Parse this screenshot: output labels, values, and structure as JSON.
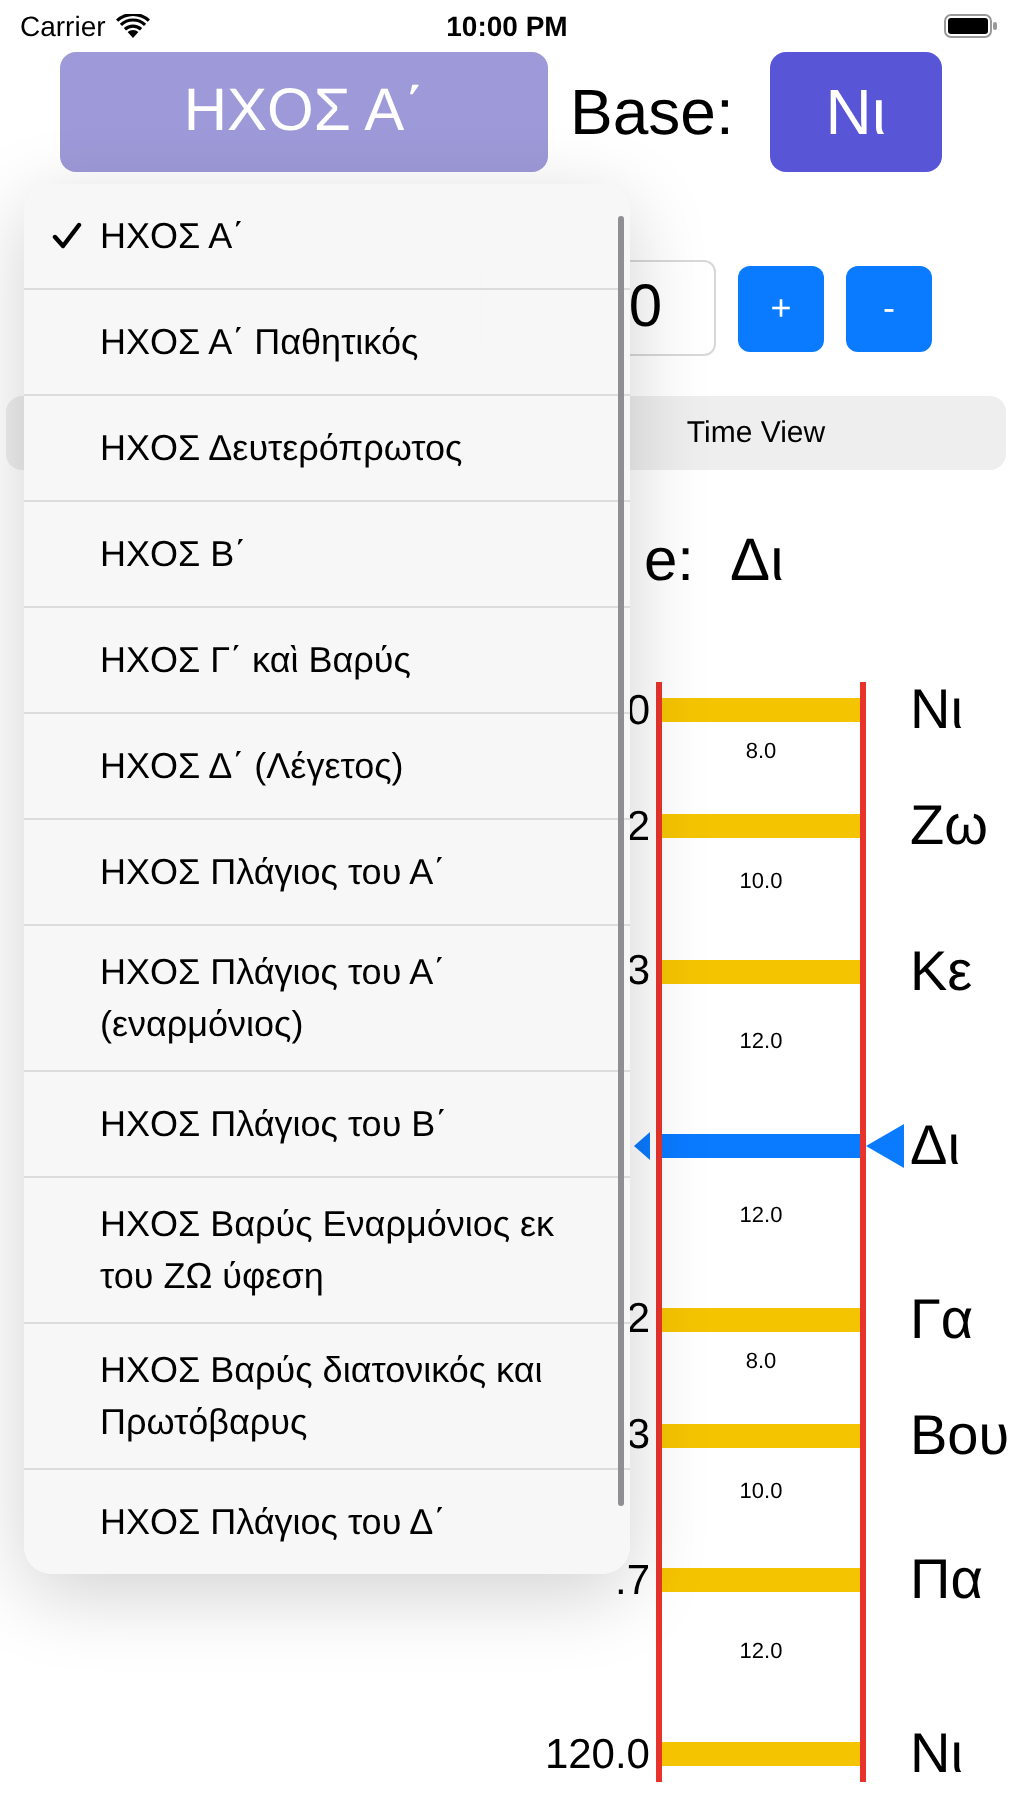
{
  "status_bar": {
    "carrier": "Carrier",
    "time": "10:00 PM"
  },
  "mode_button": {
    "label": "ΗΧΟΣ Α΄"
  },
  "base": {
    "label": "Base:",
    "button": "Nι"
  },
  "stepper": {
    "value": "0",
    "buttons": [
      "+",
      "-"
    ]
  },
  "segments": [
    {
      "label": "Time View"
    }
  ],
  "current": {
    "label": "e:",
    "value": "Δι"
  },
  "scale": {
    "notes": [
      {
        "name": "Nι",
        "tick": "0",
        "selected": false
      },
      {
        "name": "Ζω",
        "tick": "2",
        "selected": false
      },
      {
        "name": "Κε",
        "tick": "3",
        "selected": false
      },
      {
        "name": "Δι",
        "selected": true
      },
      {
        "name": "Γα",
        "tick": "2",
        "selected": false
      },
      {
        "name": "Βου",
        "tick": "3",
        "selected": false
      },
      {
        "name": "Πα",
        "tick": ".7",
        "selected": false
      },
      {
        "name": "Nι",
        "tick": "120.0",
        "selected": false
      }
    ],
    "intervals": [
      "8.0",
      "10.0",
      "12.0",
      "12.0",
      "8.0",
      "10.0",
      "12.0"
    ]
  },
  "menu": {
    "items": [
      {
        "label": "ΗΧΟΣ Α΄",
        "checked": true
      },
      {
        "label": "ΗΧΟΣ Α΄ Παθητικός",
        "checked": false
      },
      {
        "label": "ΗΧΟΣ Δευτερόπρωτος",
        "checked": false
      },
      {
        "label": "ΗΧΟΣ Β΄",
        "checked": false
      },
      {
        "label": "ΗΧΟΣ Γ΄ καὶ Βαρύς",
        "checked": false
      },
      {
        "label": "ΗΧΟΣ Δ΄ (Λέγετος)",
        "checked": false
      },
      {
        "label": "ΗΧΟΣ Πλάγιος του Α΄",
        "checked": false
      },
      {
        "label": "ΗΧΟΣ Πλάγιος του Α΄ (εναρμόνιος)",
        "checked": false
      },
      {
        "label": "ΗΧΟΣ Πλάγιος του Β΄",
        "checked": false
      },
      {
        "label": "ΗΧΟΣ Βαρύς Εναρμόνιος εκ του ΖΩ ύφεση",
        "checked": false
      },
      {
        "label": "ΗΧΟΣ Βαρύς διατονικός και Πρωτόβαρυς",
        "checked": false
      },
      {
        "label": "ΗΧΟΣ Πλάγιος του Δ΄",
        "checked": false
      }
    ]
  }
}
